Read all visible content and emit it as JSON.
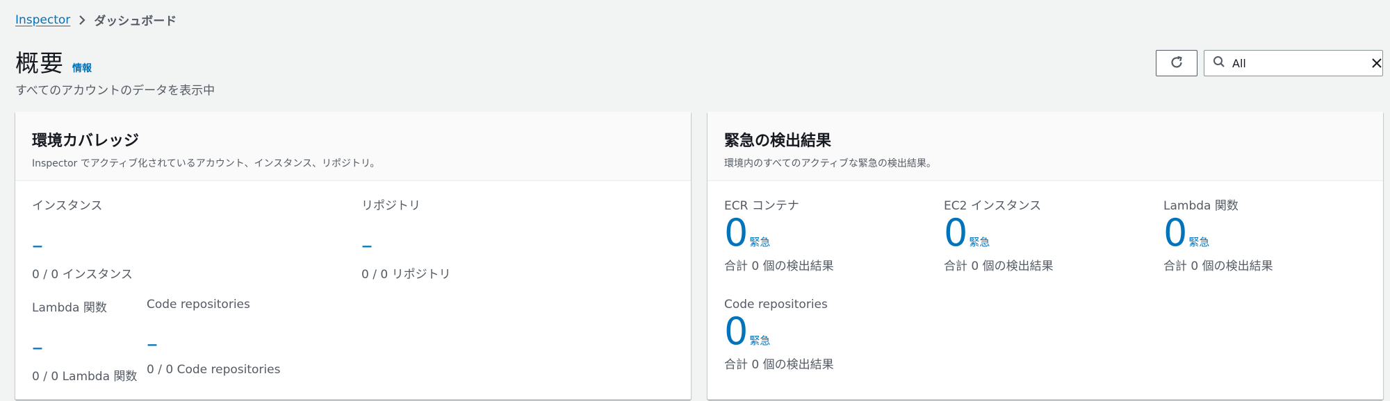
{
  "breadcrumb": {
    "root": "Inspector",
    "current": "ダッシュボード"
  },
  "header": {
    "title": "概要",
    "info": "情報",
    "subtitle": "すべてのアカウントのデータを表示中"
  },
  "toolbar": {
    "search_value": "All",
    "icons": {
      "refresh": "refresh-icon",
      "search": "search-icon",
      "clear": "close-icon"
    }
  },
  "coverage": {
    "title": "環境カバレッジ",
    "description": "Inspector でアクティブ化されているアカウント、インスタンス、リポジトリ。",
    "stats": [
      {
        "label": "インスタンス",
        "value": "–",
        "sub": "0 / 0 インスタンス"
      },
      {
        "label": "リポジトリ",
        "value": "–",
        "sub": "0 / 0 リポジトリ"
      },
      {
        "label": "Lambda 関数",
        "value": "–",
        "sub": "0 / 0 Lambda 関数"
      },
      {
        "label": "Code repositories",
        "value": "–",
        "sub": "0 / 0 Code repositories"
      }
    ]
  },
  "critical": {
    "title": "緊急の検出結果",
    "description": "環境内のすべてのアクティブな緊急の検出結果。",
    "items": [
      {
        "label": "ECR コンテナ",
        "count": "0",
        "severity": "緊急",
        "sub": "合計 0 個の検出結果"
      },
      {
        "label": "EC2 インスタンス",
        "count": "0",
        "severity": "緊急",
        "sub": "合計 0 個の検出結果"
      },
      {
        "label": "Lambda 関数",
        "count": "0",
        "severity": "緊急",
        "sub": "合計 0 個の検出結果"
      },
      {
        "label": "Code repositories",
        "count": "0",
        "severity": "緊急",
        "sub": "合計 0 個の検出結果"
      }
    ]
  },
  "colors": {
    "link": "#0073bb",
    "text": "#16191f",
    "secondary_text": "#545b64",
    "background": "#f2f3f3"
  }
}
